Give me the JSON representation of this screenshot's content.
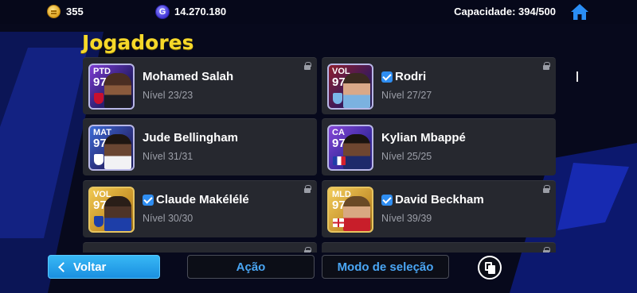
{
  "top_bar": {
    "coins_icon": "coin-icon",
    "coins": "355",
    "gp_icon": "gp-icon",
    "gp_letter": "G",
    "gp": "14.270.180",
    "capacity": "Capacidade: 394/500",
    "home_icon": "home-icon"
  },
  "title": "Jogadores",
  "players": [
    {
      "position": "PTD",
      "rating": "97",
      "name": "Mohamed Salah",
      "level": "Nível 23/23",
      "verified": false,
      "locked": true
    },
    {
      "position": "VOL",
      "rating": "97",
      "name": "Rodri",
      "level": "Nível 27/27",
      "verified": true,
      "locked": true
    },
    {
      "position": "MAT",
      "rating": "97",
      "name": "Jude Bellingham",
      "level": "Nível 31/31",
      "verified": false,
      "locked": false
    },
    {
      "position": "CA",
      "rating": "97",
      "name": "Kylian Mbappé",
      "level": "Nível 25/25",
      "verified": false,
      "locked": false
    },
    {
      "position": "VOL",
      "rating": "97",
      "name": "Claude Makélélé",
      "level": "Nível 30/30",
      "verified": true,
      "locked": true
    },
    {
      "position": "MLD",
      "rating": "97",
      "name": "David Beckham",
      "level": "Nível 39/39",
      "verified": true,
      "locked": true
    }
  ],
  "bottom_bar": {
    "back_label": "Voltar",
    "action_label": "Ação",
    "selection_label": "Modo de seleção",
    "copy_icon": "copy-icon"
  },
  "colors": {
    "title": "#f6d82a",
    "accent_blue": "#1a8fe0",
    "card_bg": "#26282f",
    "button_text": "#4aa6f4",
    "background": "#07091c"
  }
}
